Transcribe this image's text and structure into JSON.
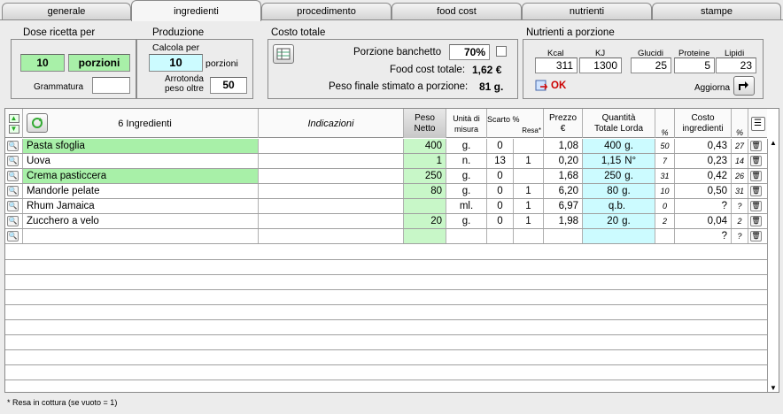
{
  "tabs": [
    "generale",
    "ingredienti",
    "procedimento",
    "food cost",
    "nutrienti",
    "stampe"
  ],
  "dose": {
    "title": "Dose ricetta per",
    "qty": "10",
    "unit": "porzioni",
    "grammatura_label": "Grammatura",
    "grammatura": ""
  },
  "produzione": {
    "title": "Produzione",
    "calcola_label": "Calcola per",
    "calcola": "10",
    "porzioni": "porzioni",
    "arrotonda_label1": "Arrotonda",
    "arrotonda_label2": "peso oltre",
    "arrotonda": "50"
  },
  "costo": {
    "title": "Costo totale",
    "banchetto_label": "Porzione banchetto",
    "banchetto": "70%",
    "food_cost_label": "Food cost totale:",
    "food_cost": "1,62 €",
    "peso_label": "Peso finale stimato a porzione:",
    "peso": "81 g."
  },
  "nutrienti": {
    "title": "Nutrienti a porzione",
    "labels": [
      "Kcal",
      "KJ",
      "Glucidi",
      "Proteine",
      "Lipidi"
    ],
    "values": [
      "311",
      "1300",
      "25",
      "5",
      "23"
    ],
    "ok": "OK",
    "aggiorna": "Aggiorna"
  },
  "table": {
    "count_label": "6 Ingredienti",
    "headers": {
      "indicazioni": "Indicazioni",
      "peso1": "Peso",
      "peso2": "Netto",
      "unita1": "Unità di",
      "unita2": "misura",
      "scarto": "Scarto %",
      "resa": "Resa*",
      "prezzo1": "Prezzo",
      "prezzo2": "€",
      "qta1": "Quantità",
      "qta2": "Totale Lorda",
      "pct": "%",
      "costo1": "Costo",
      "costo2": "ingredienti",
      "pct2": "%"
    },
    "rows": [
      {
        "name": "Pasta sfoglia",
        "green": true,
        "peso": "400",
        "um": "g.",
        "scarto": "0",
        "resa": "",
        "prezzo": "1,08",
        "qta": "400",
        "qum": "g.",
        "p1": "50",
        "costo": "0,43",
        "p2": "27"
      },
      {
        "name": "Uova",
        "green": false,
        "peso": "1",
        "um": "n.",
        "scarto": "13",
        "resa": "1",
        "prezzo": "0,20",
        "qta": "1,15",
        "qum": "N°",
        "p1": "7",
        "costo": "0,23",
        "p2": "14"
      },
      {
        "name": "Crema pasticcera",
        "green": true,
        "peso": "250",
        "um": "g.",
        "scarto": "0",
        "resa": "",
        "prezzo": "1,68",
        "qta": "250",
        "qum": "g.",
        "p1": "31",
        "costo": "0,42",
        "p2": "26"
      },
      {
        "name": "Mandorle pelate",
        "green": false,
        "peso": "80",
        "um": "g.",
        "scarto": "0",
        "resa": "1",
        "prezzo": "6,20",
        "qta": "80",
        "qum": "g.",
        "p1": "10",
        "costo": "0,50",
        "p2": "31"
      },
      {
        "name": "Rhum Jamaica",
        "green": false,
        "peso": "",
        "um": "ml.",
        "scarto": "0",
        "resa": "1",
        "prezzo": "6,97",
        "qta": "q.b.",
        "qum": "",
        "p1": "0",
        "costo": "?",
        "p2": "?"
      },
      {
        "name": "Zucchero a velo",
        "green": false,
        "peso": "20",
        "um": "g.",
        "scarto": "0",
        "resa": "1",
        "prezzo": "1,98",
        "qta": "20",
        "qum": "g.",
        "p1": "2",
        "costo": "0,04",
        "p2": "2"
      },
      {
        "name": "",
        "green": false,
        "peso": "",
        "um": "",
        "scarto": "",
        "resa": "",
        "prezzo": "",
        "qta": "",
        "qum": "",
        "p1": "",
        "costo": "?",
        "p2": "?"
      }
    ]
  },
  "footnote": "* Resa in cottura (se vuoto = 1)"
}
